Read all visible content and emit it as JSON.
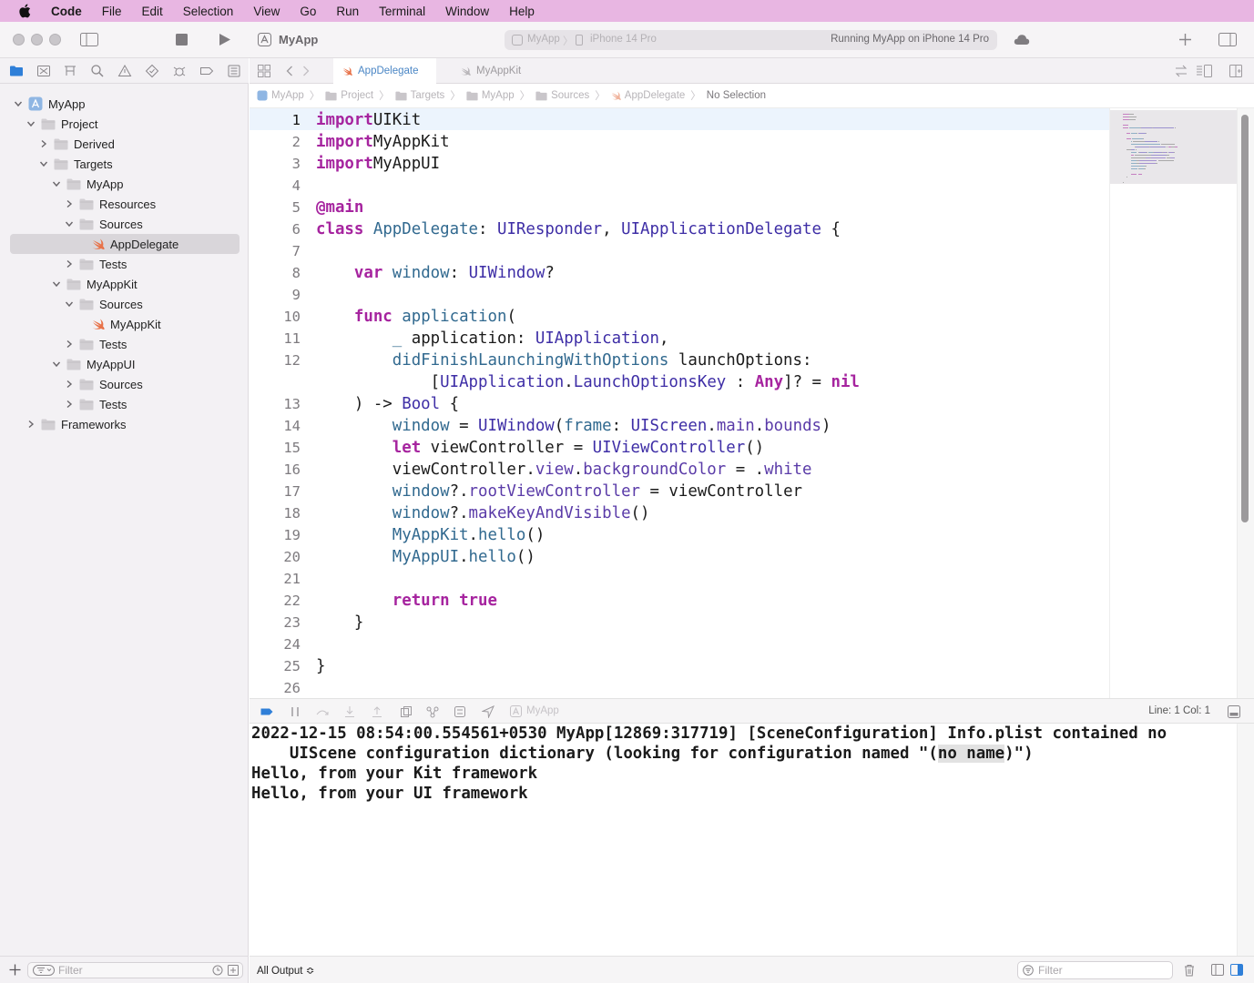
{
  "menubar": {
    "app": "Code",
    "items": [
      "File",
      "Edit",
      "Selection",
      "View",
      "Go",
      "Run",
      "Terminal",
      "Window",
      "Help"
    ]
  },
  "titlebar": {
    "title": "MyApp",
    "scheme": "MyApp",
    "device": "iPhone 14 Pro",
    "status": "Running MyApp on iPhone 14 Pro"
  },
  "navigator": {
    "tree": [
      {
        "label": "MyApp",
        "kind": "project",
        "level": 0,
        "open": true
      },
      {
        "label": "Project",
        "kind": "folder",
        "level": 1,
        "open": true
      },
      {
        "label": "Derived",
        "kind": "folder",
        "level": 2,
        "open": false
      },
      {
        "label": "Targets",
        "kind": "folder",
        "level": 2,
        "open": true
      },
      {
        "label": "MyApp",
        "kind": "folder",
        "level": 3,
        "open": true
      },
      {
        "label": "Resources",
        "kind": "folder",
        "level": 4,
        "open": false
      },
      {
        "label": "Sources",
        "kind": "folder",
        "level": 4,
        "open": true
      },
      {
        "label": "AppDelegate",
        "kind": "swift",
        "level": 5,
        "selected": true
      },
      {
        "label": "Tests",
        "kind": "folder",
        "level": 4,
        "open": false
      },
      {
        "label": "MyAppKit",
        "kind": "folder",
        "level": 3,
        "open": true
      },
      {
        "label": "Sources",
        "kind": "folder",
        "level": 4,
        "open": true
      },
      {
        "label": "MyAppKit",
        "kind": "swift",
        "level": 5
      },
      {
        "label": "Tests",
        "kind": "folder",
        "level": 4,
        "open": false
      },
      {
        "label": "MyAppUI",
        "kind": "folder",
        "level": 3,
        "open": true
      },
      {
        "label": "Sources",
        "kind": "folder",
        "level": 4,
        "open": false
      },
      {
        "label": "Tests",
        "kind": "folder",
        "level": 4,
        "open": false
      },
      {
        "label": "Frameworks",
        "kind": "folder",
        "level": 1,
        "open": false
      }
    ],
    "filter_placeholder": "Filter"
  },
  "tabs": [
    {
      "label": "AppDelegate",
      "active": true
    },
    {
      "label": "MyAppKit",
      "active": false
    }
  ],
  "jumpbar": {
    "crumbs": [
      "MyApp",
      "Project",
      "Targets",
      "MyApp",
      "Sources",
      "AppDelegate"
    ],
    "last": "No Selection"
  },
  "editor": {
    "current_line": 1,
    "lines": [
      {
        "n": "1",
        "tokens": [
          [
            "k",
            "import"
          ],
          [
            "",
            "UIKit"
          ]
        ]
      },
      {
        "n": "2",
        "tokens": [
          [
            "k",
            "import"
          ],
          [
            "",
            "MyAppKit"
          ]
        ]
      },
      {
        "n": "3",
        "tokens": [
          [
            "k",
            "import"
          ],
          [
            "",
            "MyAppUI"
          ]
        ]
      },
      {
        "n": "4",
        "tokens": []
      },
      {
        "n": "5",
        "tokens": [
          [
            "k",
            "@main"
          ]
        ]
      },
      {
        "n": "6",
        "tokens": [
          [
            "k",
            "class"
          ],
          [
            "",
            " "
          ],
          [
            "f",
            "AppDelegate"
          ],
          [
            "",
            ": "
          ],
          [
            "t",
            "UIResponder"
          ],
          [
            "",
            ", "
          ],
          [
            "t",
            "UIApplicationDelegate"
          ],
          [
            "",
            " {"
          ]
        ]
      },
      {
        "n": "7",
        "tokens": []
      },
      {
        "n": "8",
        "tokens": [
          [
            "",
            "    "
          ],
          [
            "k",
            "var"
          ],
          [
            "",
            " "
          ],
          [
            "f",
            "window"
          ],
          [
            "",
            ": "
          ],
          [
            "t",
            "UIWindow"
          ],
          [
            "",
            "?"
          ]
        ]
      },
      {
        "n": "9",
        "tokens": []
      },
      {
        "n": "10",
        "tokens": [
          [
            "",
            "    "
          ],
          [
            "k",
            "func"
          ],
          [
            "",
            " "
          ],
          [
            "f",
            "application"
          ],
          [
            "",
            "("
          ]
        ]
      },
      {
        "n": "11",
        "tokens": [
          [
            "",
            "        "
          ],
          [
            "f",
            "_"
          ],
          [
            "",
            " application: "
          ],
          [
            "t",
            "UIApplication"
          ],
          [
            "",
            ","
          ]
        ]
      },
      {
        "n": "12",
        "tokens": [
          [
            "",
            "        "
          ],
          [
            "f",
            "didFinishLaunchingWithOptions"
          ],
          [
            "",
            " launchOptions:"
          ]
        ]
      },
      {
        "n": "",
        "tokens": [
          [
            "",
            "            ["
          ],
          [
            "t",
            "UIApplication"
          ],
          [
            "",
            "."
          ],
          [
            "t",
            "LaunchOptionsKey"
          ],
          [
            "",
            " : "
          ],
          [
            "k",
            "Any"
          ],
          [
            "",
            "]? = "
          ],
          [
            "k",
            "nil"
          ]
        ]
      },
      {
        "n": "13",
        "tokens": [
          [
            "",
            "    ) -> "
          ],
          [
            "t",
            "Bool"
          ],
          [
            "",
            " {"
          ]
        ]
      },
      {
        "n": "14",
        "tokens": [
          [
            "",
            "        "
          ],
          [
            "f",
            "window"
          ],
          [
            "",
            " = "
          ],
          [
            "t",
            "UIWindow"
          ],
          [
            "",
            "("
          ],
          [
            "f",
            "frame"
          ],
          [
            "",
            ": "
          ],
          [
            "t",
            "UIScreen"
          ],
          [
            "",
            "."
          ],
          [
            "p",
            "main"
          ],
          [
            "",
            "."
          ],
          [
            "p",
            "bounds"
          ],
          [
            "",
            ")"
          ]
        ]
      },
      {
        "n": "15",
        "tokens": [
          [
            "",
            "        "
          ],
          [
            "k",
            "let"
          ],
          [
            "",
            " viewController = "
          ],
          [
            "t",
            "UIViewController"
          ],
          [
            "",
            "()"
          ]
        ]
      },
      {
        "n": "16",
        "tokens": [
          [
            "",
            "        viewController."
          ],
          [
            "p",
            "view"
          ],
          [
            "",
            "."
          ],
          [
            "p",
            "backgroundColor"
          ],
          [
            "",
            " = ."
          ],
          [
            "p",
            "white"
          ]
        ]
      },
      {
        "n": "17",
        "tokens": [
          [
            "",
            "        "
          ],
          [
            "f",
            "window"
          ],
          [
            "",
            "?."
          ],
          [
            "p",
            "rootViewController"
          ],
          [
            "",
            " = viewController"
          ]
        ]
      },
      {
        "n": "18",
        "tokens": [
          [
            "",
            "        "
          ],
          [
            "f",
            "window"
          ],
          [
            "",
            "?."
          ],
          [
            "p",
            "makeKeyAndVisible"
          ],
          [
            "",
            "()"
          ]
        ]
      },
      {
        "n": "19",
        "tokens": [
          [
            "",
            "        "
          ],
          [
            "f",
            "MyAppKit"
          ],
          [
            "",
            "."
          ],
          [
            "f",
            "hello"
          ],
          [
            "",
            "()"
          ]
        ]
      },
      {
        "n": "20",
        "tokens": [
          [
            "",
            "        "
          ],
          [
            "f",
            "MyAppUI"
          ],
          [
            "",
            "."
          ],
          [
            "f",
            "hello"
          ],
          [
            "",
            "()"
          ]
        ]
      },
      {
        "n": "21",
        "tokens": []
      },
      {
        "n": "22",
        "tokens": [
          [
            "",
            "        "
          ],
          [
            "k",
            "return"
          ],
          [
            "",
            " "
          ],
          [
            "k",
            "true"
          ]
        ]
      },
      {
        "n": "23",
        "tokens": [
          [
            "",
            "    }"
          ]
        ]
      },
      {
        "n": "24",
        "tokens": []
      },
      {
        "n": "25",
        "tokens": [
          [
            "",
            "}"
          ]
        ]
      },
      {
        "n": "26",
        "tokens": []
      }
    ]
  },
  "debugbar": {
    "target": "MyApp",
    "cursor": "Line: 1  Col: 1"
  },
  "console": {
    "lines": [
      {
        "parts": [
          "2022-12-15 08:54:00.554561+0530 MyApp[12869:317719] [SceneConfiguration] Info.plist contained no"
        ]
      },
      {
        "parts": [
          "    UIScene configuration dictionary (looking for configuration named \"(",
          "no name",
          ")\")"
        ]
      },
      {
        "parts": [
          "Hello, from your Kit framework"
        ]
      },
      {
        "parts": [
          "Hello, from your UI framework"
        ]
      }
    ],
    "output_select": "All Output ≎",
    "filter_placeholder": "Filter"
  }
}
